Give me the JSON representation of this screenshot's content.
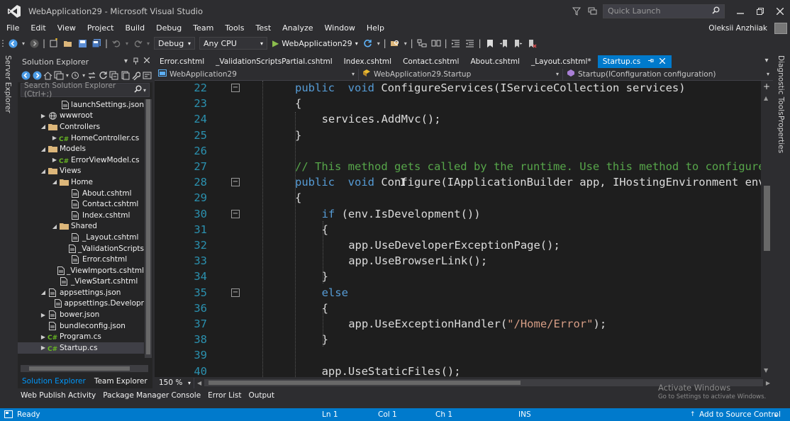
{
  "window": {
    "title": "WebApplication29 - Microsoft Visual Studio",
    "quick_launch_placeholder": "Quick Launch"
  },
  "menu": [
    "File",
    "Edit",
    "View",
    "Project",
    "Build",
    "Debug",
    "Team",
    "Tools",
    "Test",
    "Analyze",
    "Window",
    "Help"
  ],
  "user": {
    "name": "Oleksii Anzhiiak"
  },
  "toolbar": {
    "configuration": "Debug",
    "platform": "Any CPU",
    "run_target": "WebApplication29"
  },
  "left_strip": {
    "server_explorer": "Server Explorer"
  },
  "right_strip": {
    "diagnostic_tools": "Diagnostic Tools",
    "properties": "Properties"
  },
  "solution_explorer": {
    "title": "Solution Explorer",
    "search_placeholder": "Search Solution Explorer (Ctrl+;)",
    "tree": [
      {
        "label": "launchSettings.json",
        "depth": 3,
        "arrow": "",
        "icon": "file"
      },
      {
        "label": "wwwroot",
        "depth": 1,
        "arrow": "▶",
        "icon": "globe"
      },
      {
        "label": "Controllers",
        "depth": 1,
        "arrow": "◢",
        "icon": "folder"
      },
      {
        "label": "HomeController.cs",
        "depth": 2,
        "arrow": "▶",
        "icon": "cs"
      },
      {
        "label": "Models",
        "depth": 1,
        "arrow": "◢",
        "icon": "folder"
      },
      {
        "label": "ErrorViewModel.cs",
        "depth": 2,
        "arrow": "▶",
        "icon": "cs"
      },
      {
        "label": "Views",
        "depth": 1,
        "arrow": "◢",
        "icon": "folder"
      },
      {
        "label": "Home",
        "depth": 2,
        "arrow": "◢",
        "icon": "folder"
      },
      {
        "label": "About.cshtml",
        "depth": 3,
        "arrow": "",
        "icon": "file"
      },
      {
        "label": "Contact.cshtml",
        "depth": 3,
        "arrow": "",
        "icon": "file"
      },
      {
        "label": "Index.cshtml",
        "depth": 3,
        "arrow": "",
        "icon": "file"
      },
      {
        "label": "Shared",
        "depth": 2,
        "arrow": "◢",
        "icon": "folder"
      },
      {
        "label": "_Layout.cshtml",
        "depth": 3,
        "arrow": "",
        "icon": "file"
      },
      {
        "label": "_ValidationScripts",
        "depth": 3,
        "arrow": "",
        "icon": "file"
      },
      {
        "label": "Error.cshtml",
        "depth": 3,
        "arrow": "",
        "icon": "file"
      },
      {
        "label": "_ViewImports.cshtml",
        "depth": 2,
        "arrow": "",
        "icon": "file"
      },
      {
        "label": "_ViewStart.cshtml",
        "depth": 2,
        "arrow": "",
        "icon": "file"
      },
      {
        "label": "appsettings.json",
        "depth": 1,
        "arrow": "◢",
        "icon": "file"
      },
      {
        "label": "appsettings.Developr",
        "depth": 2,
        "arrow": "",
        "icon": "file"
      },
      {
        "label": "bower.json",
        "depth": 1,
        "arrow": "▶",
        "icon": "file"
      },
      {
        "label": "bundleconfig.json",
        "depth": 1,
        "arrow": "",
        "icon": "file"
      },
      {
        "label": "Program.cs",
        "depth": 1,
        "arrow": "▶",
        "icon": "cs"
      },
      {
        "label": "Startup.cs",
        "depth": 1,
        "arrow": "▶",
        "icon": "cs",
        "selected": true
      }
    ],
    "tabs": [
      "Solution Explorer",
      "Team Explorer"
    ]
  },
  "doc_tabs": [
    {
      "label": "Error.cshtml"
    },
    {
      "label": "_ValidationScriptsPartial.cshtml"
    },
    {
      "label": "Index.cshtml"
    },
    {
      "label": "Contact.cshtml"
    },
    {
      "label": "About.cshtml"
    },
    {
      "label": "_Layout.cshtml*"
    },
    {
      "label": "Startup.cs",
      "active": true
    }
  ],
  "nav_bar": {
    "project": "WebApplication29",
    "class": "WebApplication29.Startup",
    "member": "Startup(IConfiguration configuration)"
  },
  "editor": {
    "zoom": "150 %",
    "lines": [
      {
        "num": "22",
        "fold": "−",
        "indent": 0,
        "tokens": [
          [
            "kw",
            "public"
          ],
          [
            "",
            "  "
          ],
          [
            "kw",
            "void"
          ],
          [
            "",
            " ConfigureServices(IServiceCollection services)"
          ]
        ]
      },
      {
        "num": "23",
        "indent": 0,
        "tokens": [
          [
            "",
            "{"
          ]
        ]
      },
      {
        "num": "24",
        "indent": 1,
        "tokens": [
          [
            "",
            "services.AddMvc();"
          ]
        ]
      },
      {
        "num": "25",
        "indent": 0,
        "tokens": [
          [
            "",
            "}"
          ]
        ]
      },
      {
        "num": "26",
        "indent": 0,
        "tokens": []
      },
      {
        "num": "27",
        "indent": 0,
        "tokens": [
          [
            "cm",
            "// This method gets called by the runtime. Use this method to configure"
          ]
        ]
      },
      {
        "num": "28",
        "fold": "−",
        "indent": 0,
        "tokens": [
          [
            "kw",
            "public"
          ],
          [
            "",
            "  "
          ],
          [
            "kw",
            "void"
          ],
          [
            "",
            " Configure(IApplicationBuilder app, IHostingEnvironment env"
          ]
        ]
      },
      {
        "num": "29",
        "indent": 0,
        "tokens": [
          [
            "",
            "{"
          ]
        ]
      },
      {
        "num": "30",
        "fold": "−",
        "indent": 1,
        "tokens": [
          [
            "kw",
            "if"
          ],
          [
            "",
            " (env.IsDevelopment())"
          ]
        ]
      },
      {
        "num": "31",
        "indent": 1,
        "tokens": [
          [
            "",
            "{"
          ]
        ]
      },
      {
        "num": "32",
        "indent": 2,
        "tokens": [
          [
            "",
            "app.UseDeveloperExceptionPage();"
          ]
        ]
      },
      {
        "num": "33",
        "indent": 2,
        "tokens": [
          [
            "",
            "app.UseBrowserLink();"
          ]
        ]
      },
      {
        "num": "34",
        "indent": 1,
        "tokens": [
          [
            "",
            "}"
          ]
        ]
      },
      {
        "num": "35",
        "fold": "−",
        "indent": 1,
        "tokens": [
          [
            "kw",
            "else"
          ]
        ]
      },
      {
        "num": "36",
        "indent": 1,
        "tokens": [
          [
            "",
            "{"
          ]
        ]
      },
      {
        "num": "37",
        "indent": 2,
        "tokens": [
          [
            "",
            "app.UseExceptionHandler("
          ],
          [
            "str",
            "\"/Home/Error\""
          ],
          [
            "",
            ");"
          ]
        ]
      },
      {
        "num": "38",
        "indent": 1,
        "tokens": [
          [
            "",
            "}"
          ]
        ]
      },
      {
        "num": "39",
        "indent": 0,
        "tokens": []
      },
      {
        "num": "40",
        "indent": 1,
        "tokens": [
          [
            "",
            "app.UseStaticFiles();"
          ]
        ]
      }
    ]
  },
  "bottom_tabs": [
    "Web Publish Activity",
    "Package Manager Console",
    "Error List",
    "Output"
  ],
  "watermark": {
    "line1": "Activate Windows",
    "line2": "Go to Settings to activate Windows."
  },
  "status_bar": {
    "state": "Ready",
    "ln": "Ln 1",
    "col": "Col 1",
    "ch": "Ch 1",
    "mode": "INS",
    "source_control": "Add to Source Control"
  }
}
